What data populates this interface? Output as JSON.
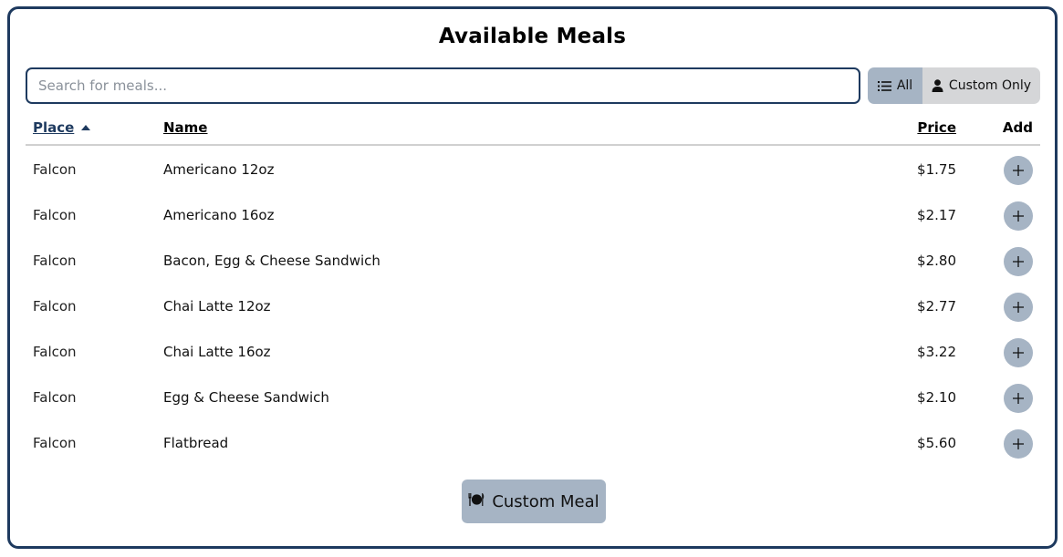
{
  "page": {
    "title": "Available Meals"
  },
  "search": {
    "placeholder": "Search for meals..."
  },
  "filters": {
    "all_label": "All",
    "custom_only_label": "Custom Only",
    "selected": "All"
  },
  "table": {
    "headers": {
      "place": "Place",
      "name": "Name",
      "price": "Price",
      "add": "Add"
    },
    "sort": {
      "column": "Place",
      "direction": "ascending"
    },
    "rows": [
      {
        "place": "Falcon",
        "name": "Americano 12oz",
        "price": "$1.75"
      },
      {
        "place": "Falcon",
        "name": "Americano 16oz",
        "price": "$2.17"
      },
      {
        "place": "Falcon",
        "name": "Bacon, Egg & Cheese Sandwich",
        "price": "$2.80"
      },
      {
        "place": "Falcon",
        "name": "Chai Latte 12oz",
        "price": "$2.77"
      },
      {
        "place": "Falcon",
        "name": "Chai Latte 16oz",
        "price": "$3.22"
      },
      {
        "place": "Falcon",
        "name": "Egg & Cheese Sandwich",
        "price": "$2.10"
      },
      {
        "place": "Falcon",
        "name": "Flatbread",
        "price": "$5.60"
      }
    ]
  },
  "actions": {
    "custom_meal_label": "Custom Meal"
  },
  "icons": {
    "list": "list-icon",
    "user": "user-icon",
    "plus": "plus-icon",
    "sort": "sort-ascending-icon",
    "plate": "plate-utensils-icon"
  },
  "colors": {
    "border": "#1e3a5f",
    "accent": "#a6b4c4",
    "inactive_toggle": "#d5d6d8",
    "header_link": "#1e3a5f"
  }
}
